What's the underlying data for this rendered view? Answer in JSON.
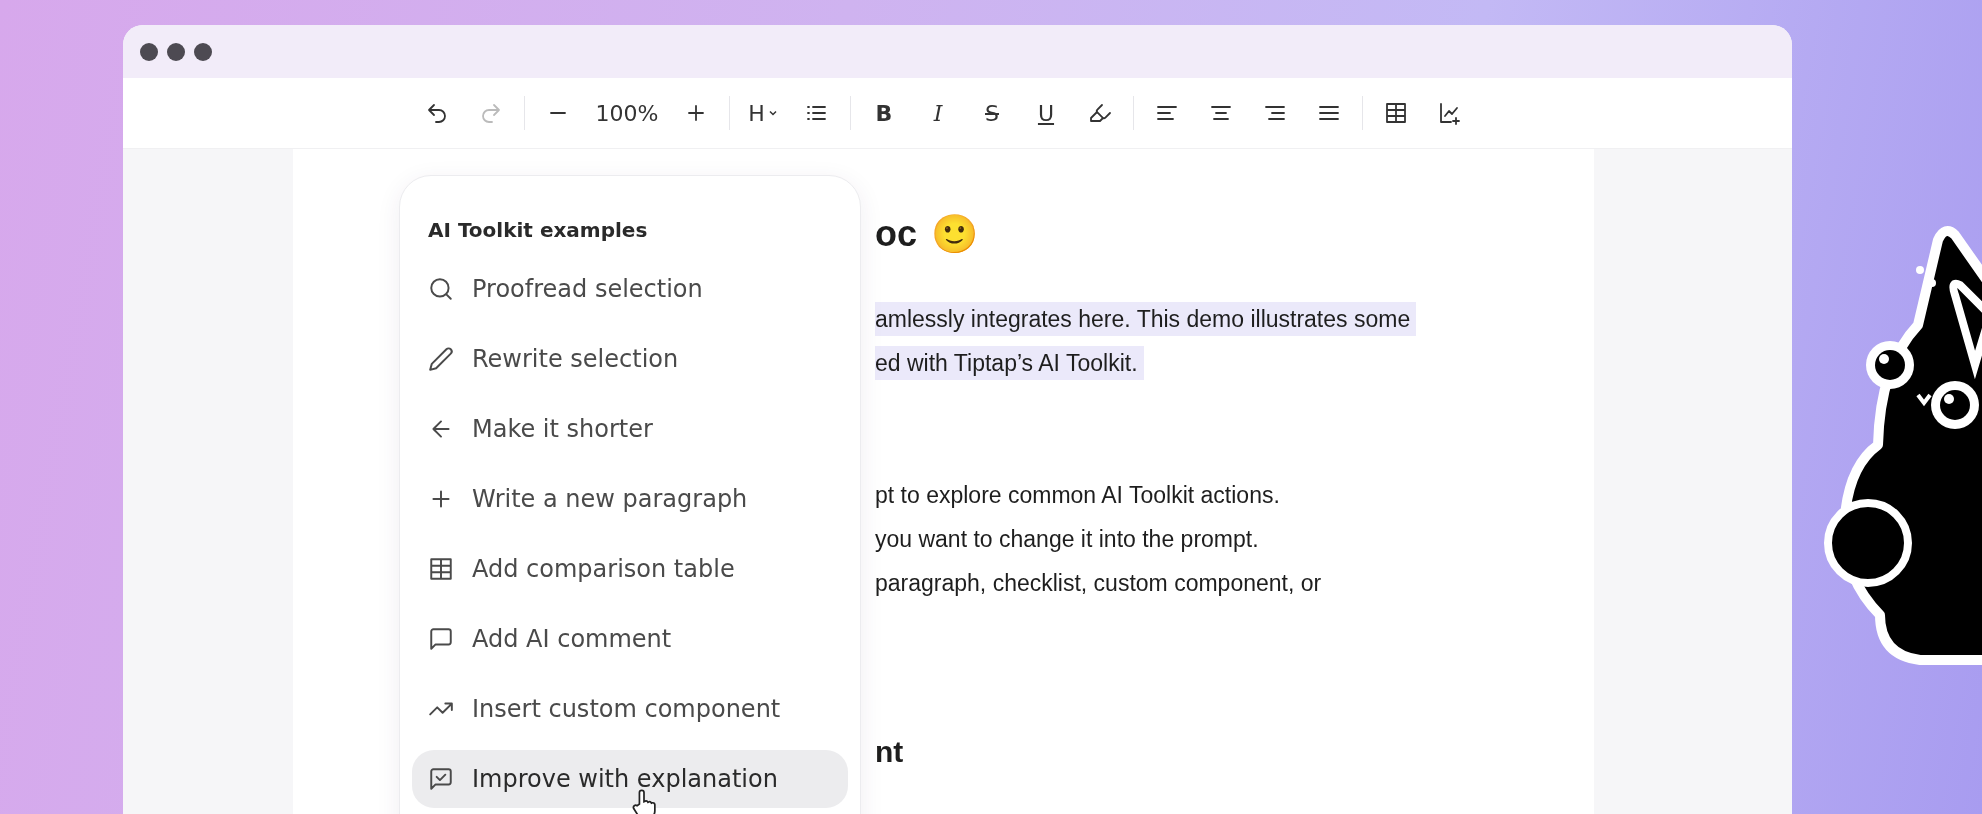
{
  "toolbar": [
    {
      "kind": "undo",
      "disabled": false
    },
    {
      "kind": "redo",
      "disabled": true
    },
    {
      "kind": "separator"
    },
    {
      "kind": "zoom-out",
      "disabled": false
    },
    {
      "kind": "zoom-level",
      "label": "100%",
      "disabled": false
    },
    {
      "kind": "zoom-in",
      "disabled": false
    },
    {
      "kind": "separator"
    },
    {
      "kind": "heading",
      "label": "H",
      "disabled": false
    },
    {
      "kind": "list",
      "disabled": false
    },
    {
      "kind": "separator"
    },
    {
      "kind": "bold",
      "label": "B",
      "disabled": false
    },
    {
      "kind": "italic",
      "label": "I",
      "disabled": false
    },
    {
      "kind": "strike",
      "label": "S",
      "disabled": false
    },
    {
      "kind": "underline",
      "label": "U",
      "disabled": false
    },
    {
      "kind": "highlight",
      "disabled": false
    },
    {
      "kind": "separator"
    },
    {
      "kind": "align-left",
      "disabled": false
    },
    {
      "kind": "align-center",
      "disabled": false
    },
    {
      "kind": "align-right",
      "disabled": false
    },
    {
      "kind": "align-justify",
      "disabled": false
    },
    {
      "kind": "separator"
    },
    {
      "kind": "table",
      "disabled": false
    },
    {
      "kind": "chart",
      "disabled": false
    }
  ],
  "document": {
    "blocks": [
      {
        "kind": "heading",
        "text": "oc",
        "emoji": "🙂"
      },
      {
        "kind": "paragraph",
        "highlighted": true,
        "lines": [
          "amlessly integrates here. This demo illustrates some",
          "ed with Tiptap’s AI Toolkit."
        ]
      },
      {
        "kind": "paragraph",
        "highlighted": false,
        "lines": [
          "pt to explore common AI Toolkit actions.",
          "you want to change it into the prompt.",
          "paragraph, checklist, custom component, or"
        ]
      },
      {
        "kind": "subheading",
        "text": "nt"
      }
    ]
  },
  "menu": {
    "title": "AI Toolkit examples",
    "items": [
      {
        "kind": "search",
        "label": "Proofread selection",
        "selected": false
      },
      {
        "kind": "pencil",
        "label": "Rewrite selection",
        "selected": false
      },
      {
        "kind": "arrow-left",
        "label": "Make it shorter",
        "selected": false
      },
      {
        "kind": "plus",
        "label": "Write a new paragraph",
        "selected": false
      },
      {
        "kind": "table",
        "label": "Add comparison table",
        "selected": false
      },
      {
        "kind": "comment",
        "label": "Add AI comment",
        "selected": false
      },
      {
        "kind": "trend",
        "label": "Insert custom component",
        "selected": false
      },
      {
        "kind": "comment-check",
        "label": "Improve with explanation",
        "selected": true
      }
    ]
  }
}
